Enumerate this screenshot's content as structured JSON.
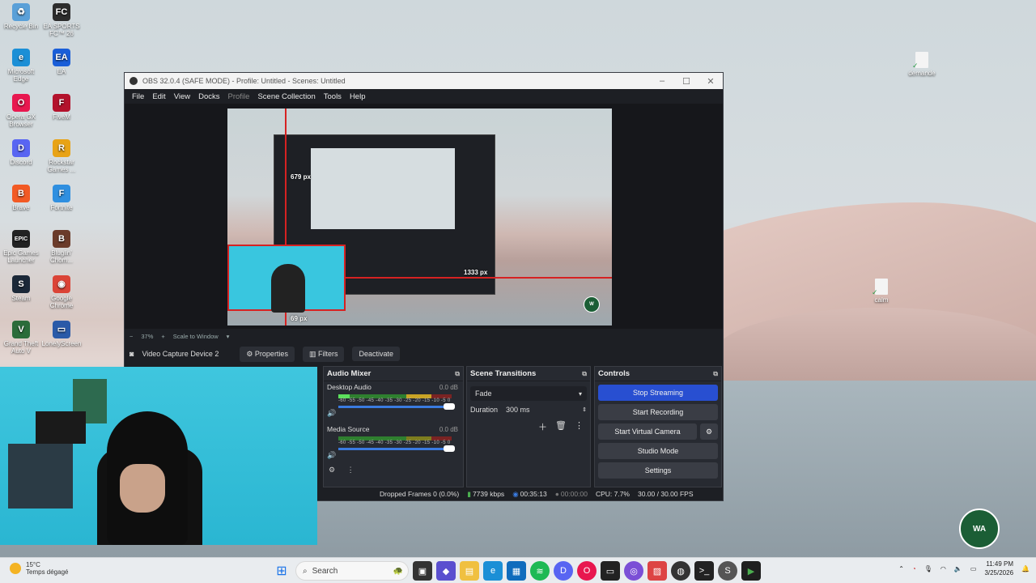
{
  "desktop": {
    "icons": [
      {
        "label": "Recycle Bin",
        "icon": "recycle-bin-icon",
        "color": "#5aa0d8",
        "glyph": "♻"
      },
      {
        "label": "EA SPORTS FC™ 26",
        "icon": "ea-fc-icon",
        "color": "#2c2c2c",
        "glyph": "FC"
      },
      {
        "label": "Microsoft Edge",
        "icon": "edge-icon",
        "color": "#1b8fd6",
        "glyph": "e"
      },
      {
        "label": "EA",
        "icon": "ea-icon",
        "color": "#1a5ed8",
        "glyph": "EA"
      },
      {
        "label": "Opera GX Browser",
        "icon": "opera-gx-icon",
        "color": "#e8174f",
        "glyph": "O"
      },
      {
        "label": "FiveM",
        "icon": "fivem-icon",
        "color": "#b3122c",
        "glyph": "F"
      },
      {
        "label": "Discord",
        "icon": "discord-icon",
        "color": "#5865f2",
        "glyph": "D"
      },
      {
        "label": "Rockstar Games ...",
        "icon": "rockstar-icon",
        "color": "#e8a317",
        "glyph": "R"
      },
      {
        "label": "Brave",
        "icon": "brave-icon",
        "color": "#f25a24",
        "glyph": "B"
      },
      {
        "label": "Fortnite",
        "icon": "fortnite-icon",
        "color": "#2f8fe0",
        "glyph": "F"
      },
      {
        "label": "Epic Games Launcher",
        "icon": "epic-games-icon",
        "color": "#222222",
        "glyph": "EPIC"
      },
      {
        "label": "Bluglin' Chom...",
        "icon": "game-icon",
        "color": "#6b3b2a",
        "glyph": "B"
      },
      {
        "label": "Steam",
        "icon": "steam-icon",
        "color": "#1b2838",
        "glyph": "S"
      },
      {
        "label": "Google Chrome",
        "icon": "chrome-icon",
        "color": "#db4437",
        "glyph": "◉"
      },
      {
        "label": "Grand Theft Auto V",
        "icon": "gta-icon",
        "color": "#2b6c3a",
        "glyph": "V"
      },
      {
        "label": "LonelyScreen",
        "icon": "lonelyscreen-icon",
        "color": "#2a5aa8",
        "glyph": "▭"
      }
    ],
    "files": [
      {
        "label": "demande",
        "icon": "document-icon"
      },
      {
        "label": "calm",
        "icon": "document-icon"
      }
    ]
  },
  "obs": {
    "title": "OBS 32.0.4 (SAFE MODE) - Profile: Untitled - Scenes: Untitled",
    "menu": [
      "File",
      "Edit",
      "View",
      "Docks",
      "Profile",
      "Scene Collection",
      "Tools",
      "Help"
    ],
    "preview": {
      "label_top": "679 px",
      "label_right": "1333 px",
      "label_bottom": "69 px"
    },
    "zoom": {
      "minus": "−",
      "value": "37%",
      "plus": "+",
      "mode": "Scale to Window"
    },
    "source": {
      "name": "Video Capture Device 2",
      "properties": "Properties",
      "filters": "Filters",
      "deactivate": "Deactivate"
    },
    "audio_mixer": {
      "title": "Audio Mixer",
      "channels": [
        {
          "name": "Desktop Audio",
          "db": "0.0 dB"
        },
        {
          "name": "Media Source",
          "db": "0.0 dB"
        }
      ],
      "scale": "-60 -55 -50 -45 -40 -35 -30 -25 -20 -15 -10 -5 0"
    },
    "transitions": {
      "title": "Scene Transitions",
      "type": "Fade",
      "duration_label": "Duration",
      "duration": "300 ms"
    },
    "controls": {
      "title": "Controls",
      "stop_streaming": "Stop Streaming",
      "start_recording": "Start Recording",
      "start_virtual_camera": "Start Virtual Camera",
      "studio_mode": "Studio Mode",
      "settings": "Settings"
    },
    "status": {
      "dropped": "Dropped Frames 0 (0.0%)",
      "bitrate": "7739 kbps",
      "stream_time": "00:35:13",
      "rec_time": "00:00:00",
      "cpu": "CPU: 7.7%",
      "fps": "30.00 / 30.00 FPS"
    },
    "accent": "#284fd1"
  },
  "taskbar": {
    "weather_temp": "15°C",
    "weather_desc": "Temps dégagé",
    "search_placeholder": "Search",
    "time": "11:49 PM",
    "date": "3/25/2026"
  }
}
